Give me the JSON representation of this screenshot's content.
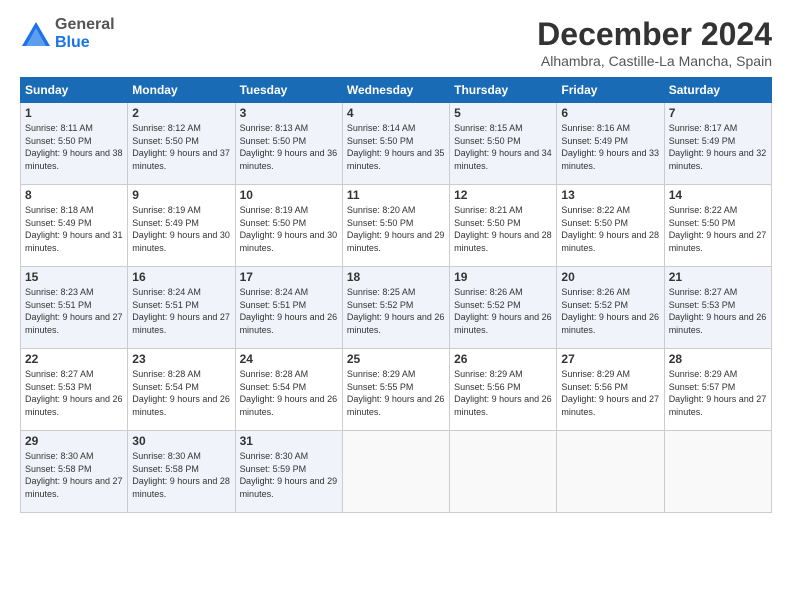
{
  "logo": {
    "general": "General",
    "blue": "Blue"
  },
  "title": "December 2024",
  "location": "Alhambra, Castille-La Mancha, Spain",
  "days_header": [
    "Sunday",
    "Monday",
    "Tuesday",
    "Wednesday",
    "Thursday",
    "Friday",
    "Saturday"
  ],
  "weeks": [
    [
      {
        "day": "1",
        "sunrise": "Sunrise: 8:11 AM",
        "sunset": "Sunset: 5:50 PM",
        "daylight": "Daylight: 9 hours and 38 minutes."
      },
      {
        "day": "2",
        "sunrise": "Sunrise: 8:12 AM",
        "sunset": "Sunset: 5:50 PM",
        "daylight": "Daylight: 9 hours and 37 minutes."
      },
      {
        "day": "3",
        "sunrise": "Sunrise: 8:13 AM",
        "sunset": "Sunset: 5:50 PM",
        "daylight": "Daylight: 9 hours and 36 minutes."
      },
      {
        "day": "4",
        "sunrise": "Sunrise: 8:14 AM",
        "sunset": "Sunset: 5:50 PM",
        "daylight": "Daylight: 9 hours and 35 minutes."
      },
      {
        "day": "5",
        "sunrise": "Sunrise: 8:15 AM",
        "sunset": "Sunset: 5:50 PM",
        "daylight": "Daylight: 9 hours and 34 minutes."
      },
      {
        "day": "6",
        "sunrise": "Sunrise: 8:16 AM",
        "sunset": "Sunset: 5:49 PM",
        "daylight": "Daylight: 9 hours and 33 minutes."
      },
      {
        "day": "7",
        "sunrise": "Sunrise: 8:17 AM",
        "sunset": "Sunset: 5:49 PM",
        "daylight": "Daylight: 9 hours and 32 minutes."
      }
    ],
    [
      {
        "day": "8",
        "sunrise": "Sunrise: 8:18 AM",
        "sunset": "Sunset: 5:49 PM",
        "daylight": "Daylight: 9 hours and 31 minutes."
      },
      {
        "day": "9",
        "sunrise": "Sunrise: 8:19 AM",
        "sunset": "Sunset: 5:49 PM",
        "daylight": "Daylight: 9 hours and 30 minutes."
      },
      {
        "day": "10",
        "sunrise": "Sunrise: 8:19 AM",
        "sunset": "Sunset: 5:50 PM",
        "daylight": "Daylight: 9 hours and 30 minutes."
      },
      {
        "day": "11",
        "sunrise": "Sunrise: 8:20 AM",
        "sunset": "Sunset: 5:50 PM",
        "daylight": "Daylight: 9 hours and 29 minutes."
      },
      {
        "day": "12",
        "sunrise": "Sunrise: 8:21 AM",
        "sunset": "Sunset: 5:50 PM",
        "daylight": "Daylight: 9 hours and 28 minutes."
      },
      {
        "day": "13",
        "sunrise": "Sunrise: 8:22 AM",
        "sunset": "Sunset: 5:50 PM",
        "daylight": "Daylight: 9 hours and 28 minutes."
      },
      {
        "day": "14",
        "sunrise": "Sunrise: 8:22 AM",
        "sunset": "Sunset: 5:50 PM",
        "daylight": "Daylight: 9 hours and 27 minutes."
      }
    ],
    [
      {
        "day": "15",
        "sunrise": "Sunrise: 8:23 AM",
        "sunset": "Sunset: 5:51 PM",
        "daylight": "Daylight: 9 hours and 27 minutes."
      },
      {
        "day": "16",
        "sunrise": "Sunrise: 8:24 AM",
        "sunset": "Sunset: 5:51 PM",
        "daylight": "Daylight: 9 hours and 27 minutes."
      },
      {
        "day": "17",
        "sunrise": "Sunrise: 8:24 AM",
        "sunset": "Sunset: 5:51 PM",
        "daylight": "Daylight: 9 hours and 26 minutes."
      },
      {
        "day": "18",
        "sunrise": "Sunrise: 8:25 AM",
        "sunset": "Sunset: 5:52 PM",
        "daylight": "Daylight: 9 hours and 26 minutes."
      },
      {
        "day": "19",
        "sunrise": "Sunrise: 8:26 AM",
        "sunset": "Sunset: 5:52 PM",
        "daylight": "Daylight: 9 hours and 26 minutes."
      },
      {
        "day": "20",
        "sunrise": "Sunrise: 8:26 AM",
        "sunset": "Sunset: 5:52 PM",
        "daylight": "Daylight: 9 hours and 26 minutes."
      },
      {
        "day": "21",
        "sunrise": "Sunrise: 8:27 AM",
        "sunset": "Sunset: 5:53 PM",
        "daylight": "Daylight: 9 hours and 26 minutes."
      }
    ],
    [
      {
        "day": "22",
        "sunrise": "Sunrise: 8:27 AM",
        "sunset": "Sunset: 5:53 PM",
        "daylight": "Daylight: 9 hours and 26 minutes."
      },
      {
        "day": "23",
        "sunrise": "Sunrise: 8:28 AM",
        "sunset": "Sunset: 5:54 PM",
        "daylight": "Daylight: 9 hours and 26 minutes."
      },
      {
        "day": "24",
        "sunrise": "Sunrise: 8:28 AM",
        "sunset": "Sunset: 5:54 PM",
        "daylight": "Daylight: 9 hours and 26 minutes."
      },
      {
        "day": "25",
        "sunrise": "Sunrise: 8:29 AM",
        "sunset": "Sunset: 5:55 PM",
        "daylight": "Daylight: 9 hours and 26 minutes."
      },
      {
        "day": "26",
        "sunrise": "Sunrise: 8:29 AM",
        "sunset": "Sunset: 5:56 PM",
        "daylight": "Daylight: 9 hours and 26 minutes."
      },
      {
        "day": "27",
        "sunrise": "Sunrise: 8:29 AM",
        "sunset": "Sunset: 5:56 PM",
        "daylight": "Daylight: 9 hours and 27 minutes."
      },
      {
        "day": "28",
        "sunrise": "Sunrise: 8:29 AM",
        "sunset": "Sunset: 5:57 PM",
        "daylight": "Daylight: 9 hours and 27 minutes."
      }
    ],
    [
      {
        "day": "29",
        "sunrise": "Sunrise: 8:30 AM",
        "sunset": "Sunset: 5:58 PM",
        "daylight": "Daylight: 9 hours and 27 minutes."
      },
      {
        "day": "30",
        "sunrise": "Sunrise: 8:30 AM",
        "sunset": "Sunset: 5:58 PM",
        "daylight": "Daylight: 9 hours and 28 minutes."
      },
      {
        "day": "31",
        "sunrise": "Sunrise: 8:30 AM",
        "sunset": "Sunset: 5:59 PM",
        "daylight": "Daylight: 9 hours and 29 minutes."
      },
      null,
      null,
      null,
      null
    ]
  ]
}
